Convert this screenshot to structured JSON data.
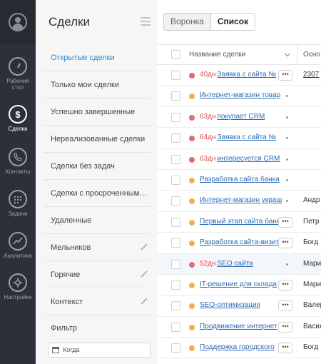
{
  "colors": {
    "rail_bg": "#2c3139",
    "active_link": "#2a8ccd",
    "overdue_red": "#e04c4c",
    "status_red": "#e36b6b",
    "status_orange": "#f0b04a"
  },
  "rail": {
    "items": [
      {
        "label": "Рабочий стол",
        "icon": "dashboard-gauge-icon",
        "active": false
      },
      {
        "label": "Сделки",
        "icon": "dollar-icon",
        "active": true
      },
      {
        "label": "Контакты",
        "icon": "phone-icon",
        "active": false
      },
      {
        "label": "Задачи",
        "icon": "calendar-icon",
        "active": false
      },
      {
        "label": "Аналитика",
        "icon": "chart-line-icon",
        "active": false
      },
      {
        "label": "Настройки",
        "icon": "gear-icon",
        "active": false
      }
    ]
  },
  "menu": {
    "title": "Сделки",
    "items": [
      {
        "label": "Открытые сделки",
        "active": true,
        "editable": false
      },
      {
        "label": "Только мои сделки",
        "active": false,
        "editable": false
      },
      {
        "label": "Успешно завершенные",
        "active": false,
        "editable": false
      },
      {
        "label": "Нереализованные сделки",
        "active": false,
        "editable": false
      },
      {
        "label": "Сделки без задач",
        "active": false,
        "editable": false
      },
      {
        "label": "Сделки с просроченными ...",
        "active": false,
        "editable": false
      },
      {
        "label": "Удаленные",
        "active": false,
        "editable": false
      },
      {
        "label": "Мельников",
        "active": false,
        "editable": true
      },
      {
        "label": "Горячие",
        "active": false,
        "editable": true
      },
      {
        "label": "Контекст",
        "active": false,
        "editable": true
      }
    ],
    "filter_label": "Фильтр",
    "date_placeholder": "Когда"
  },
  "tabs": [
    {
      "label": "Воронка",
      "active": false
    },
    {
      "label": "Список",
      "active": true
    }
  ],
  "table": {
    "columns": [
      "Название сделки",
      "Осно"
    ],
    "rows": [
      {
        "status": "red",
        "days": "40дн",
        "name": "Заявка с сайта №",
        "action": "more",
        "col2": "2307",
        "col2_link": true,
        "hl": false
      },
      {
        "status": "orange",
        "days": "",
        "name": "Интернет-магазин товар",
        "action": "bullet",
        "col2": "",
        "col2_link": false,
        "hl": false
      },
      {
        "status": "red",
        "days": "63дн",
        "name": "покупает CRM",
        "action": "bullet",
        "col2": "",
        "col2_link": false,
        "hl": false
      },
      {
        "status": "red",
        "days": "64дн",
        "name": "Заявка с сайта №",
        "action": "bullet",
        "col2": "",
        "col2_link": false,
        "hl": false
      },
      {
        "status": "red",
        "days": "63дн",
        "name": "интересуется CRM",
        "action": "bullet",
        "col2": "",
        "col2_link": false,
        "hl": false
      },
      {
        "status": "orange",
        "days": "",
        "name": "Разработка сайта банка",
        "action": "bullet",
        "col2": "",
        "col2_link": false,
        "hl": false
      },
      {
        "status": "orange",
        "days": "",
        "name": "Интернет-магазин украш",
        "action": "bullet",
        "col2": "Андр",
        "col2_link": false,
        "hl": false
      },
      {
        "status": "orange",
        "days": "",
        "name": "Первый этап сайта банка",
        "action": "more",
        "col2": "Петр",
        "col2_link": false,
        "hl": false
      },
      {
        "status": "orange",
        "days": "",
        "name": "Разработка сайта-визитки",
        "action": "more",
        "col2": "Богд",
        "col2_link": false,
        "hl": false
      },
      {
        "status": "red",
        "days": "52дн",
        "name": "SEO сайта",
        "action": "bullet",
        "col2": "Мари",
        "col2_link": false,
        "hl": true
      },
      {
        "status": "orange",
        "days": "",
        "name": "IT-решение для склада",
        "action": "more",
        "col2": "Мари",
        "col2_link": false,
        "hl": false
      },
      {
        "status": "orange",
        "days": "",
        "name": "SEO-оптимизация",
        "action": "more",
        "col2": "Валер",
        "col2_link": false,
        "hl": false
      },
      {
        "status": "orange",
        "days": "",
        "name": "Продвижение интернет",
        "action": "more",
        "col2": "Васил",
        "col2_link": false,
        "hl": false
      },
      {
        "status": "orange",
        "days": "",
        "name": "Поддержка городского",
        "action": "more",
        "col2": "Богд",
        "col2_link": false,
        "hl": false
      }
    ]
  }
}
